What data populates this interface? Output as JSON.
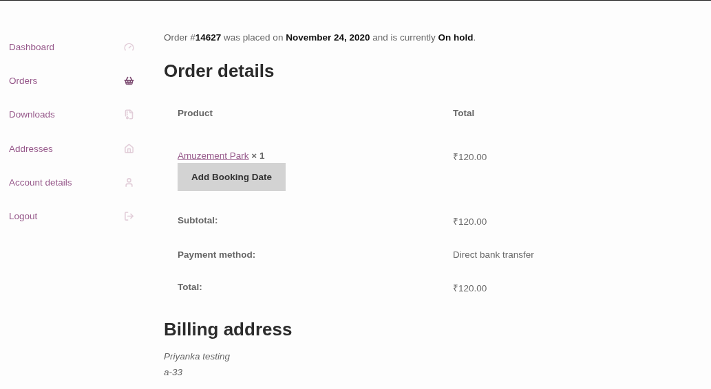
{
  "navigation": [
    {
      "label": "Dashboard",
      "selected": false
    },
    {
      "label": "Orders",
      "selected": true
    },
    {
      "label": "Downloads",
      "selected": false
    },
    {
      "label": "Addresses",
      "selected": false
    },
    {
      "label": "Account details",
      "selected": false
    },
    {
      "label": "Logout",
      "selected": false
    }
  ],
  "order_summary": "Order #**14627** was placed on **November 24, 2020** and is currently **On hold**.",
  "order_details": {
    "title": "Order details",
    "columns": [
      "Product",
      "Total"
    ],
    "items": [
      {
        "product": "Amuzement Park",
        "quantity": "× 1",
        "total": "₹120.00",
        "button": "Add Booking Date"
      }
    ],
    "totals": [
      {
        "label": "Subtotal:",
        "value": "₹120.00"
      },
      {
        "label": "Payment method:",
        "value": "Direct bank transfer"
      },
      {
        "label": "Total:",
        "value": "₹120.00"
      }
    ]
  },
  "billing_address": {
    "title": "Billing address",
    "lines": [
      "Priyanka testing",
      "a-33"
    ]
  }
}
